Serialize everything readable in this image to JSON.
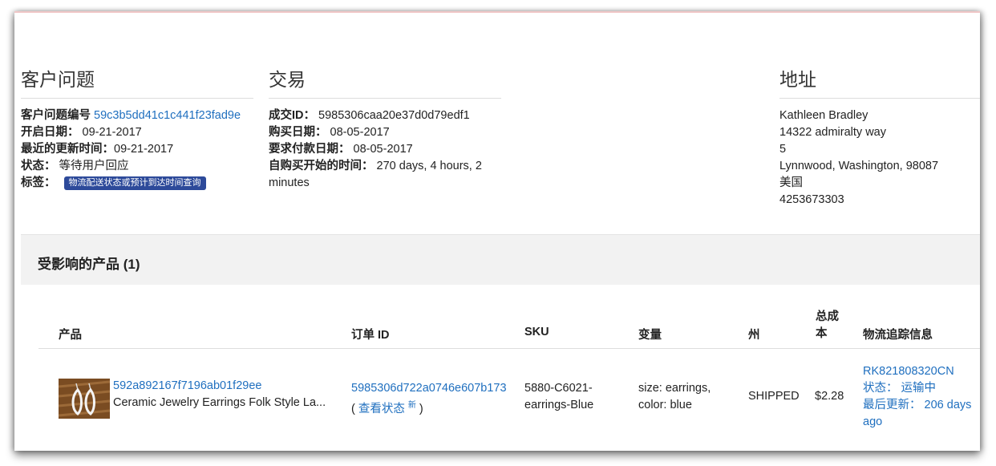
{
  "issue": {
    "title": "客户问题",
    "id_label": "客户问题编号",
    "id_value": "59c3b5dd41c1c441f23fad9e",
    "open_label": "开启日期：",
    "open_value": "09-21-2017",
    "updated_label": "最近的更新时间：",
    "updated_value": "09-21-2017",
    "status_label": "状态：",
    "status_value": "等待用户回应",
    "tag_label": "标签：",
    "tag_value": "物流配送状态或预计到达时间查询"
  },
  "transaction": {
    "title": "交易",
    "id_label": "成交ID：",
    "id_value": "5985306caa20e37d0d79edf1",
    "purchase_label": "购买日期：",
    "purchase_value": "08-05-2017",
    "payment_label": "要求付款日期：",
    "payment_value": "08-05-2017",
    "since_label": "自购买开始的时间：",
    "since_value_1": "270 days, 4 hours, 2",
    "since_value_2": "minutes"
  },
  "address": {
    "title": "地址",
    "name": "Kathleen Bradley",
    "street": "14322 admiralty way",
    "unit": "5",
    "city": "Lynnwood, Washington, 98087",
    "country": "美国",
    "phone": "4253673303"
  },
  "products": {
    "title": "受影响的产品 (1)",
    "columns": {
      "product": "产品",
      "order_id": "订单 ID",
      "sku": "SKU",
      "variant": "变量",
      "state": "州",
      "total_1": "总成",
      "total_2": "本",
      "tracking": "物流追踪信息"
    },
    "rows": [
      {
        "product_id": "592a892167f7196ab01f29ee",
        "product_name": "Ceramic Jewelry Earrings Folk Style La...",
        "order_id": "5985306d722a0746e607b173",
        "view_status": "查看状态",
        "new_badge": "新",
        "sku_1": "5880-C6021-",
        "sku_2": "earrings-Blue",
        "variant_1": "size: earrings,",
        "variant_2": "color: blue",
        "state": "SHIPPED",
        "total": "$2.28",
        "tracking_no": "RK821808320CN",
        "tracking_status": "状态：  运输中",
        "tracking_updated_1": "最后更新：  206 days",
        "tracking_updated_2": "ago"
      }
    ]
  }
}
